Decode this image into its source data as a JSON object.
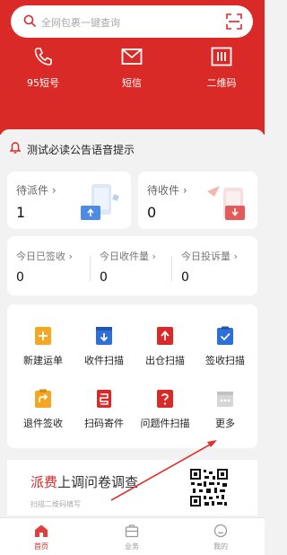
{
  "search": {
    "placeholder": "全网包裹一键查询"
  },
  "quick_actions": [
    {
      "label": "95短号",
      "icon": "phone-icon"
    },
    {
      "label": "短信",
      "icon": "envelope-icon"
    },
    {
      "label": "二维码",
      "icon": "qrcode-icon"
    }
  ],
  "notice": {
    "text": "测试必读公告语音提示"
  },
  "cards": {
    "dispatch": {
      "title": "待派件 ›",
      "count": "1"
    },
    "receive": {
      "title": "待收件 ›",
      "count": "0"
    }
  },
  "stats": [
    {
      "title": "今日已签收 ›",
      "value": "0"
    },
    {
      "title": "今日收件量 ›",
      "value": "0"
    },
    {
      "title": "今日投诉量 ›",
      "value": "0"
    }
  ],
  "grid": [
    {
      "label": "新建运单",
      "icon": "plus-doc-icon",
      "color": "#f5a623"
    },
    {
      "label": "收件扫描",
      "icon": "download-icon",
      "color": "#2f6fd8"
    },
    {
      "label": "出仓扫描",
      "icon": "upload-icon",
      "color": "#d92a28"
    },
    {
      "label": "签收扫描",
      "icon": "check-clipboard-icon",
      "color": "#2f6fd8"
    },
    {
      "label": "退件签收",
      "icon": "return-icon",
      "color": "#f5a623"
    },
    {
      "label": "扫码寄件",
      "icon": "scan-send-icon",
      "color": "#d92a28"
    },
    {
      "label": "问题件扫描",
      "icon": "question-icon",
      "color": "#d92a28"
    },
    {
      "label": "更多",
      "icon": "more-icon",
      "color": "#cccccc"
    }
  ],
  "banner": {
    "highlight": "派费",
    "rest": "上调问卷调查",
    "sub": "扫描二维码填写"
  },
  "tabs": [
    {
      "label": "首页",
      "active": true
    },
    {
      "label": "业务",
      "active": false
    },
    {
      "label": "我的",
      "active": false
    }
  ],
  "colors": {
    "brand_red": "#d92a28",
    "blue": "#2f6fd8",
    "orange": "#f5a623"
  }
}
